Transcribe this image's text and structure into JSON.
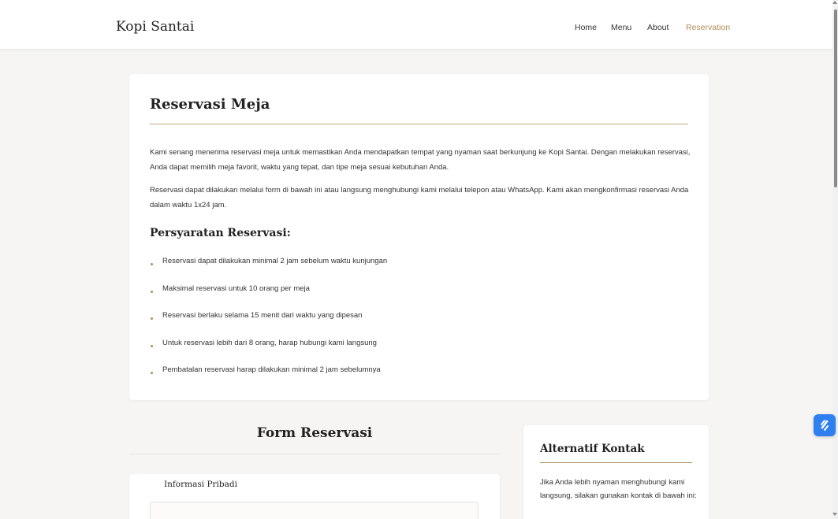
{
  "navbar": {
    "brand": "Kopi Santai",
    "links": [
      {
        "label": "Home"
      },
      {
        "label": "Menu"
      },
      {
        "label": "About"
      },
      {
        "label": "Reservation"
      }
    ]
  },
  "main": {
    "title": "Reservasi Meja",
    "paragraphs": [
      "Kami senang menerima reservasi meja untuk memastikan Anda mendapatkan tempat yang nyaman saat berkunjung ke Kopi Santai. Dengan melakukan reservasi, Anda dapat memilih meja favorit, waktu yang tepat, dan tipe meja sesuai kebutuhan Anda.",
      "Reservasi dapat dilakukan melalui form di bawah ini atau langsung menghubungi kami melalui telepon atau WhatsApp. Kami akan mengkonfirmasi reservasi Anda dalam waktu 1x24 jam."
    ],
    "requirements_title": "Persyaratan Reservasi:",
    "requirements": [
      "Reservasi dapat dilakukan minimal 2 jam sebelum waktu kunjungan",
      "Maksimal reservasi untuk 10 orang per meja",
      "Reservasi berlaku selama 15 menit dari waktu yang dipesan",
      "Untuk reservasi lebih dari 8 orang, harap hubungi kami langsung",
      "Pembatalan reservasi harap dilakukan minimal 2 jam sebelumnya"
    ]
  },
  "form": {
    "heading": "Form Reservasi",
    "section_legend": "Informasi Pribadi"
  },
  "alt_contact": {
    "title": "Alternatif Kontak",
    "text": "Jika Anda lebih nyaman menghubungi kami langsung, silakan gunakan kontak di bawah ini:"
  },
  "floating_button": {
    "icon": "extension-icon"
  },
  "colors": {
    "accent": "#b08d57",
    "rule": "#c4a77f",
    "background": "#f6f5f3",
    "floating_button": "#2f7fef"
  }
}
